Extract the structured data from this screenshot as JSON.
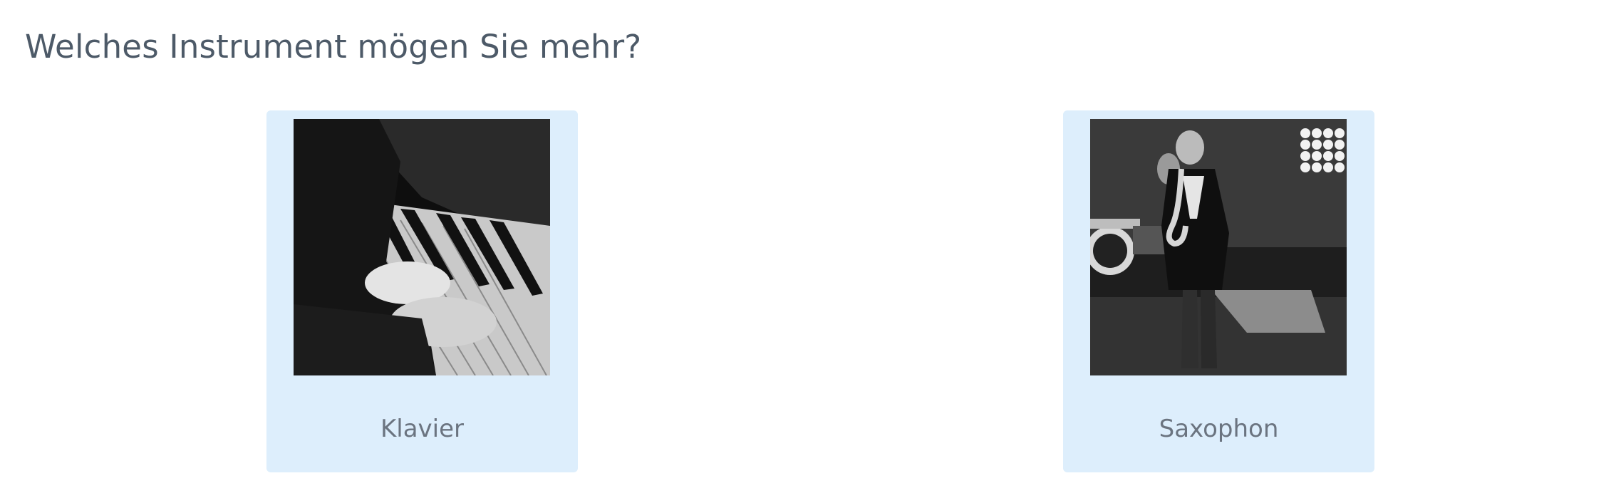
{
  "survey": {
    "question": "Welches Instrument mögen Sie mehr?",
    "choices": [
      {
        "label": "Klavier",
        "image_icon": "piano-photo"
      },
      {
        "label": "Saxophon",
        "image_icon": "saxophone-photo"
      }
    ]
  },
  "colors": {
    "card_background": "#ddeefc",
    "question_text": "#4d5a68",
    "label_text": "#6b7480"
  }
}
